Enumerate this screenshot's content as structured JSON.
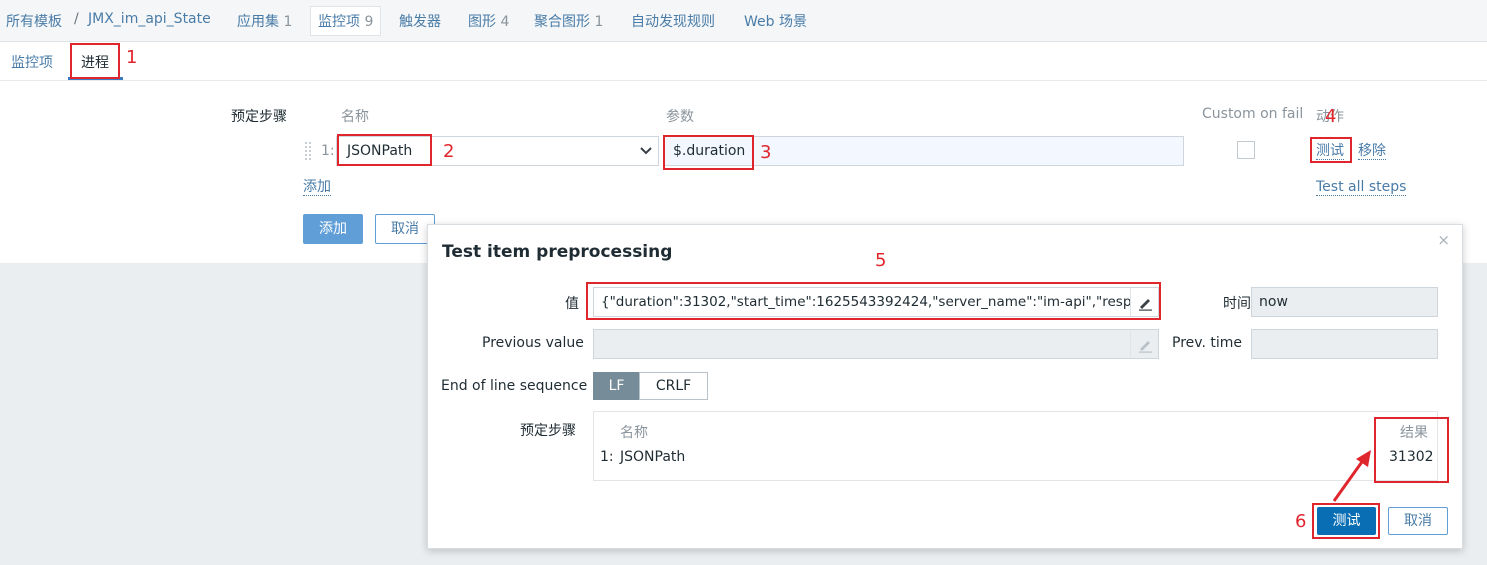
{
  "breadcrumb": {
    "all_templates": "所有模板",
    "separator": "/",
    "template_name": "JMX_im_api_State",
    "apps": "应用集",
    "apps_count": "1",
    "items": "监控项",
    "items_count": "9",
    "triggers": "触发器",
    "graphs": "图形",
    "graphs_count": "4",
    "screens": "聚合图形",
    "screens_count": "1",
    "discovery": "自动发现规则",
    "web": "Web 场景"
  },
  "subtabs": {
    "item": "监控项",
    "preprocessing": "进程"
  },
  "form": {
    "steps_label": "预定步骤",
    "col_name": "名称",
    "col_params": "参数",
    "col_custom": "Custom on fail",
    "col_actions": "动作",
    "step_num": "1:",
    "step_type": "JSONPath",
    "step_param": "$.duration",
    "test_link": "测试",
    "remove_link": "移除",
    "add_link": "添加",
    "test_all": "Test all steps",
    "add_button": "添加",
    "cancel_button": "取消"
  },
  "annotations": {
    "n1": "1",
    "n2": "2",
    "n3": "3",
    "n4": "4",
    "n5": "5",
    "n6": "6"
  },
  "dialog": {
    "title": "Test item preprocessing",
    "close": "×",
    "value_label": "值",
    "value": "{\"duration\":31302,\"start_time\":1625543392424,\"server_name\":\"im-api\",\"resp…",
    "time_label": "时间",
    "time_value": "now",
    "prev_value_label": "Previous value",
    "prev_time_label": "Prev. time",
    "eol_label": "End of line sequence",
    "eol_lf": "LF",
    "eol_crlf": "CRLF",
    "steps_label": "预定步骤",
    "steps_col_name": "名称",
    "steps_col_result": "结果",
    "step_row_num": "1:",
    "step_row_name": "JSONPath",
    "step_row_result": "31302",
    "test_button": "测试",
    "cancel_button": "取消"
  },
  "colors": {
    "accent": "#5f9ed6",
    "link": "#4a7ca8",
    "annotation_red": "#e0262d",
    "lf_selected": "#768d99"
  }
}
